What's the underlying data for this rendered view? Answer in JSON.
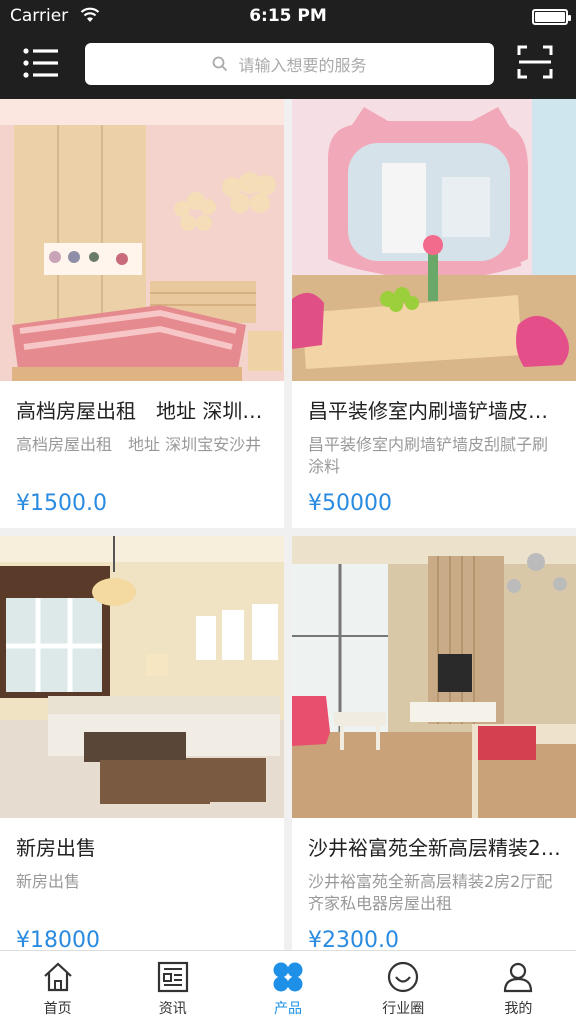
{
  "status_bar": {
    "carrier": "Carrier",
    "time": "6:15 PM"
  },
  "search": {
    "placeholder": "请输入想要的服务"
  },
  "products": [
    {
      "title": "高档房屋出租　地址 深圳宝安沙井",
      "desc": "高档房屋出租　地址 深圳宝安沙井",
      "price": "¥1500.0"
    },
    {
      "title": "昌平装修室内刷墙铲墙皮刮腻子刷涂料",
      "desc": "昌平装修室内刷墙铲墙皮刮腻子刷涂料",
      "price": "¥50000"
    },
    {
      "title": "新房出售",
      "desc": "新房出售",
      "price": "¥18000"
    },
    {
      "title": "沙井裕富苑全新高层精装2房2厅配齐家私电器房屋出租",
      "desc": "沙井裕富苑全新高层精装2房2厅配齐家私电器房屋出租",
      "price": "¥2300.0"
    }
  ],
  "tabs": [
    {
      "label": "首页",
      "icon": "home-icon",
      "active": false
    },
    {
      "label": "资讯",
      "icon": "news-icon",
      "active": false
    },
    {
      "label": "产品",
      "icon": "product-icon",
      "active": true
    },
    {
      "label": "行业圈",
      "icon": "circle-icon",
      "active": false
    },
    {
      "label": "我的",
      "icon": "user-icon",
      "active": false
    }
  ],
  "colors": {
    "header_bg": "#1f1f1f",
    "accent": "#1e90e8",
    "price": "#2a8be0"
  }
}
